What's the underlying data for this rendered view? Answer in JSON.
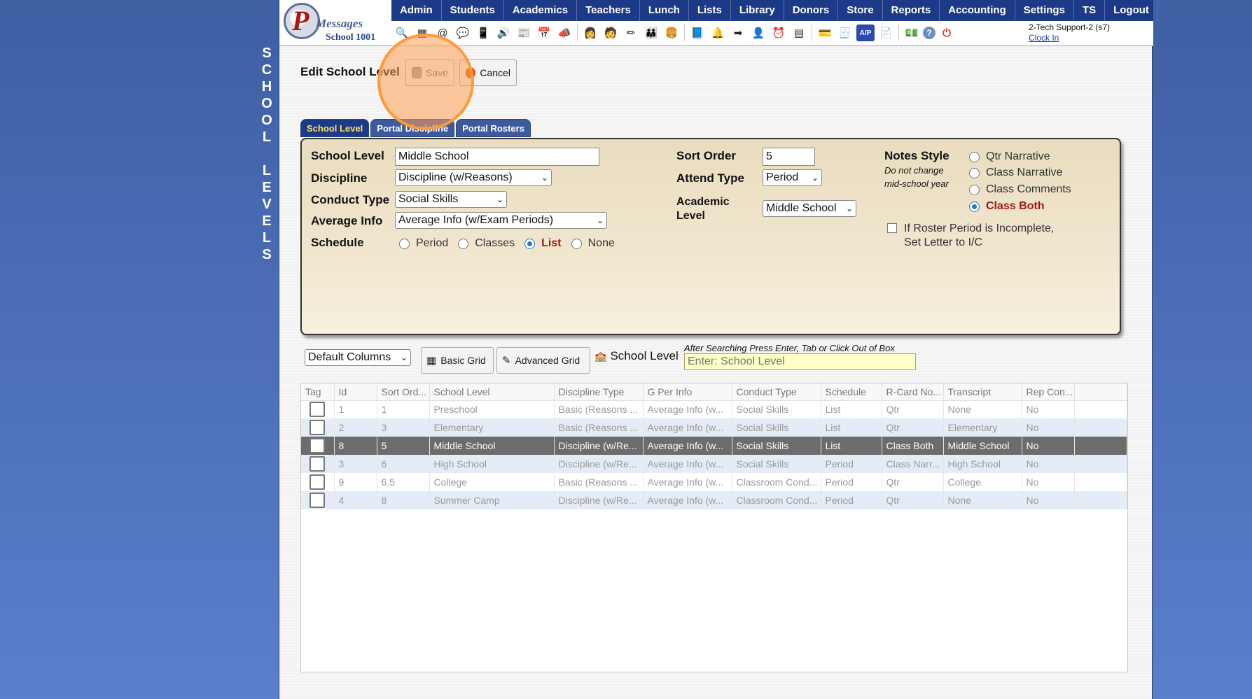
{
  "side_title": [
    "S",
    "C",
    "H",
    "O",
    "O",
    "L",
    " ",
    "L",
    "E",
    "V",
    "E",
    "L",
    "S"
  ],
  "logo": {
    "letter": "P",
    "word": "Messages",
    "school": "School 1001"
  },
  "nav": [
    "Admin",
    "Students",
    "Academics",
    "Teachers",
    "Lunch",
    "Lists",
    "Library",
    "Donors",
    "Store",
    "Reports",
    "Accounting",
    "Settings",
    "TS",
    "Logout"
  ],
  "toolbar_icons": [
    {
      "name": "search-icon",
      "glyph": "🔍"
    },
    {
      "name": "grid-icon",
      "glyph": "▦"
    },
    {
      "name": "email-icon",
      "glyph": "@"
    },
    {
      "name": "chat-icon",
      "glyph": "💬"
    },
    {
      "name": "phone-icon",
      "glyph": "📱"
    },
    {
      "name": "speaker-icon",
      "glyph": "🔊"
    },
    {
      "name": "news-icon",
      "glyph": "📰"
    },
    {
      "name": "calendar-icon",
      "glyph": "📅"
    },
    {
      "name": "megaphone-icon",
      "glyph": "📣"
    },
    {
      "name": "teacher-icon",
      "glyph": "👩"
    },
    {
      "name": "student-icon",
      "glyph": "🧑"
    },
    {
      "name": "pencil-icon",
      "glyph": "✏"
    },
    {
      "name": "family-icon",
      "glyph": "👪"
    },
    {
      "name": "lunch-icon",
      "glyph": "🍔"
    },
    {
      "name": "book-icon",
      "glyph": "📘"
    },
    {
      "name": "bell-icon",
      "glyph": "🔔"
    },
    {
      "name": "transfer-icon",
      "glyph": "➡"
    },
    {
      "name": "staff-icon",
      "glyph": "👤"
    },
    {
      "name": "clock-icon",
      "glyph": "⏰"
    },
    {
      "name": "spreadsheet-icon",
      "glyph": "▤"
    },
    {
      "name": "card-icon",
      "glyph": "💳"
    },
    {
      "name": "register-icon",
      "glyph": "🧾"
    },
    {
      "name": "ap-icon",
      "glyph": "A/P"
    },
    {
      "name": "pdf-icon",
      "glyph": "📄"
    },
    {
      "name": "money-icon",
      "glyph": "💵"
    },
    {
      "name": "help-icon",
      "glyph": "?"
    },
    {
      "name": "power-icon",
      "glyph": "⏻"
    }
  ],
  "user": {
    "name": "2-Tech Support-2 (s7)",
    "clock_in": "Clock In"
  },
  "edit": {
    "title": "Edit School Level",
    "save": "Save",
    "cancel": "Cancel"
  },
  "tabs": [
    "School Level",
    "Portal Discipline",
    "Portal Rosters"
  ],
  "form": {
    "school_level_label": "School Level",
    "school_level_value": "Middle School",
    "discipline_label": "Discipline",
    "discipline_value": "Discipline (w/Reasons)",
    "conduct_label": "Conduct Type",
    "conduct_value": "Social Skills",
    "average_label": "Average Info",
    "average_value": "Average Info (w/Exam Periods)",
    "schedule_label": "Schedule",
    "schedule_options": [
      "Period",
      "Classes",
      "List",
      "None"
    ],
    "schedule_selected": "List",
    "sort_order_label": "Sort Order",
    "sort_order_value": "5",
    "attend_label": "Attend Type",
    "attend_value": "Period",
    "academic_label_1": "Academic",
    "academic_label_2": "Level",
    "academic_value": "Middle School",
    "notes_label": "Notes Style",
    "notes_hint_1": "Do not change",
    "notes_hint_2": "mid-school year",
    "notes_options": [
      "Qtr Narrative",
      "Class Narrative",
      "Class Comments",
      "Class Both"
    ],
    "notes_selected": "Class Both",
    "roster_check_1": "If Roster Period is Incomplete,",
    "roster_check_2": "Set Letter to I/C"
  },
  "grid_toolbar": {
    "columns": "Default Columns",
    "basic": "Basic Grid",
    "advanced": "Advanced Grid",
    "label": "School Level",
    "hint": "After Searching Press Enter, Tab or Click Out of Box",
    "placeholder": "Enter: School Level"
  },
  "table": {
    "headers": [
      "Tag",
      "Id",
      "Sort Ord...",
      "School Level",
      "Discipline Type",
      "G Per Info",
      "Conduct Type",
      "Schedule",
      "R-Card No...",
      "Transcript",
      "Rep Con..."
    ],
    "rows": [
      [
        "1",
        "1",
        "Preschool",
        "Basic (Reasons ...",
        "Average Info (w...",
        "Social Skills",
        "List",
        "Qtr",
        "None",
        "No"
      ],
      [
        "2",
        "3",
        "Elementary",
        "Basic (Reasons ...",
        "Average Info (w...",
        "Social Skills",
        "List",
        "Qtr",
        "Elementary",
        "No"
      ],
      [
        "8",
        "5",
        "Middle School",
        "Discipline (w/Re...",
        "Average Info (w...",
        "Social Skills",
        "List",
        "Class Both",
        "Middle School",
        "No"
      ],
      [
        "3",
        "6",
        "High School",
        "Discipline (w/Re...",
        "Average Info (w...",
        "Social Skills",
        "Period",
        "Class Narr...",
        "High School",
        "No"
      ],
      [
        "9",
        "6.5",
        "College",
        "Basic (Reasons ...",
        "Average Info (w...",
        "Classroom Cond...",
        "Period",
        "Qtr",
        "College",
        "No"
      ],
      [
        "4",
        "8",
        "Summer Camp",
        "Discipline (w/Re...",
        "Average Info (w...",
        "Classroom Cond...",
        "Period",
        "Qtr",
        "None",
        "No"
      ]
    ],
    "selected_row": 2
  }
}
